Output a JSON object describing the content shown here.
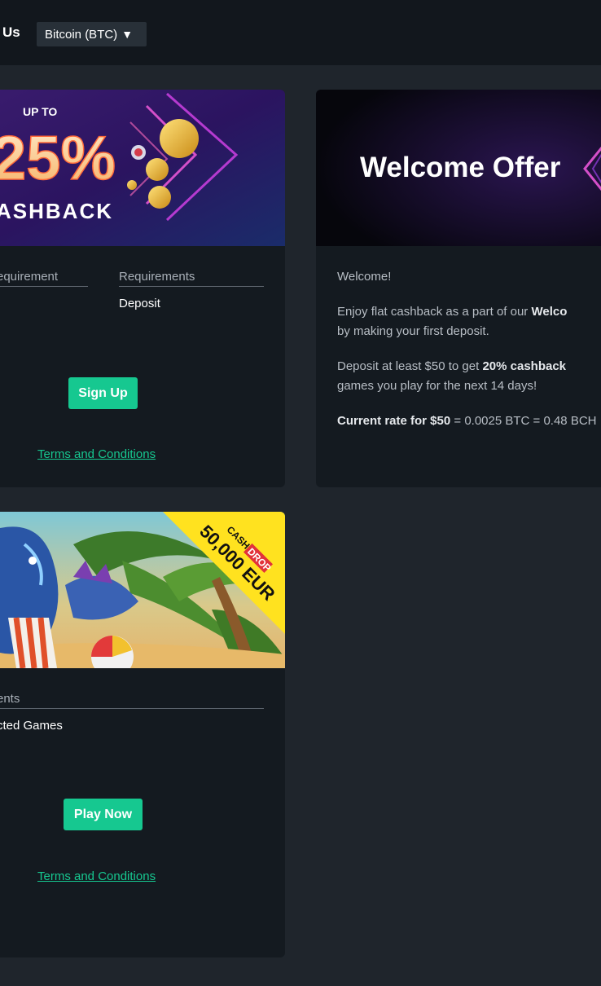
{
  "header": {
    "nav_partial": "Us",
    "currency_label": "Bitcoin (BTC)",
    "currency_arrow": "▼"
  },
  "cashback_card": {
    "banner": {
      "up_to": "UP TO",
      "percent": "25%",
      "word": "ASHBACK"
    },
    "requirements": [
      {
        "header": "equirement",
        "value": ""
      },
      {
        "header": "Requirements",
        "value": "Deposit"
      }
    ],
    "button_label": "Sign Up",
    "terms_label": "Terms and Conditions"
  },
  "welcome_card": {
    "banner_title": "Welcome Offer",
    "greeting": "Welcome!",
    "line1_a": "Enjoy flat cashback as a part of our ",
    "line1_b": "Welco",
    "line2": "by making your first deposit.",
    "line3_a": "Deposit at least $50 to get ",
    "line3_b": "20% cashback",
    "line4": "games you play for the next 14 days!",
    "rate_a": "Current rate for $50",
    "rate_b": " = 0.0025 BTC = 0.48 BCH"
  },
  "cashdrop_card": {
    "banner": {
      "tag_cash": "CASH",
      "tag_drop": "DROP",
      "amount": "50,000 EUR"
    },
    "requirements": [
      {
        "header": "ents",
        "value": "cted Games"
      }
    ],
    "button_label": "Play Now",
    "terms_label": "Terms and Conditions"
  },
  "colors": {
    "accent": "#16c890",
    "background": "#1f252c",
    "card": "#141a20",
    "header": "#12171d"
  }
}
